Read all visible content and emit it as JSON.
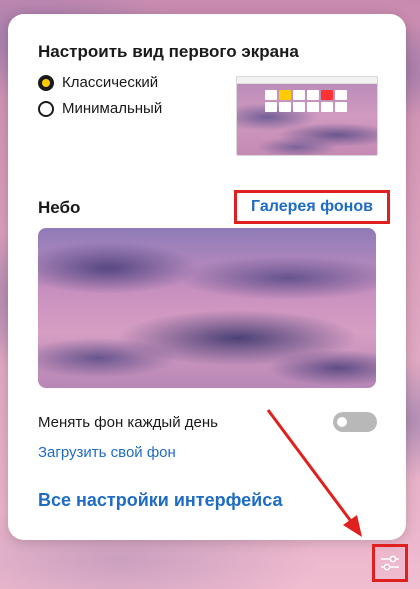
{
  "first_screen": {
    "title": "Настроить вид первого экрана",
    "options": [
      {
        "label": "Классический",
        "selected": true
      },
      {
        "label": "Минимальный",
        "selected": false
      }
    ]
  },
  "background": {
    "title": "Небо",
    "gallery_link": "Галерея фонов",
    "prev_label": "‹",
    "next_label": "›",
    "daily_change_label": "Менять фон каждый день",
    "daily_change_enabled": false,
    "upload_link": "Загрузить свой фон"
  },
  "footer": {
    "all_settings_link": "Все настройки интерфейса"
  },
  "settings_button": {
    "icon": "sliders-icon"
  },
  "annotation": {
    "highlight_color": "#e0201e"
  },
  "colors": {
    "link": "#1f6cc4",
    "radio_accent": "#ffcc00"
  }
}
